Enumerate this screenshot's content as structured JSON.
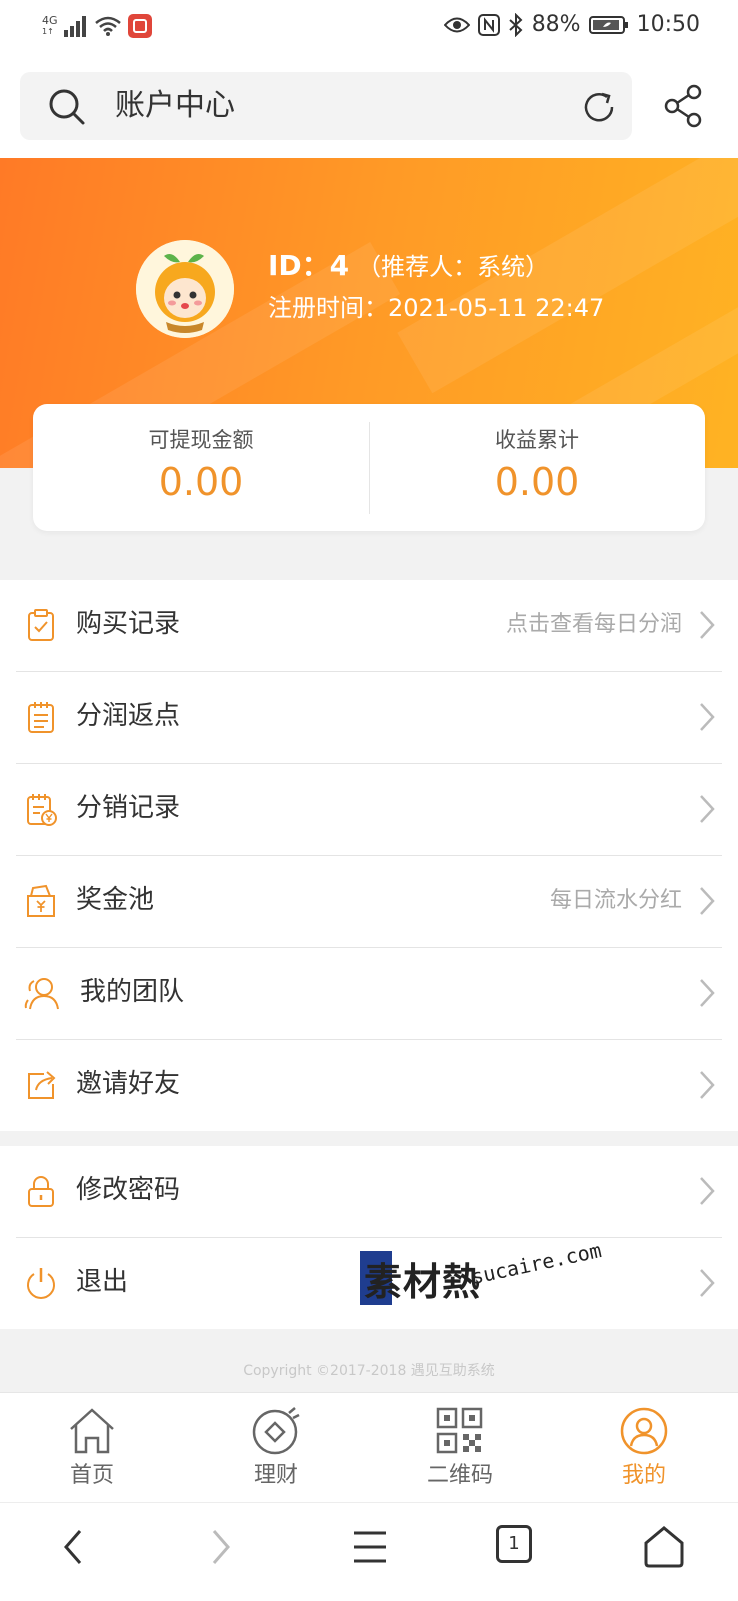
{
  "statusbar": {
    "network": "4G",
    "network_sub": "1↑",
    "battery": "88%",
    "time": "10:50"
  },
  "header": {
    "title": "账户中心"
  },
  "profile": {
    "id_text": "ID：4",
    "referrer_text": "（推荐人：系统）",
    "register_text": "注册时间：2021-05-11 22:47"
  },
  "stats": {
    "withdrawable_label": "可提现金额",
    "withdrawable_value": "0.00",
    "earnings_label": "收益累计",
    "earnings_value": "0.00"
  },
  "menu": [
    {
      "label": "购买记录",
      "hint": "点击查看每日分润",
      "icon": "clipboard-check-icon"
    },
    {
      "label": "分润返点",
      "hint": "",
      "icon": "notepad-icon"
    },
    {
      "label": "分销记录",
      "hint": "",
      "icon": "yuan-record-icon"
    },
    {
      "label": "奖金池",
      "hint": "每日流水分红",
      "icon": "prize-pool-icon"
    },
    {
      "label": "我的团队",
      "hint": "",
      "icon": "team-icon"
    },
    {
      "label": "邀请好友",
      "hint": "",
      "icon": "invite-icon"
    }
  ],
  "menu2": [
    {
      "label": "修改密码",
      "icon": "lock-icon"
    },
    {
      "label": "退出",
      "icon": "power-icon"
    }
  ],
  "watermark": {
    "brand": "素材熱",
    "domain": "sucaire.com"
  },
  "copyright": "Copyright ©2017-2018 遇见互助系统",
  "tabs": [
    {
      "label": "首页",
      "icon": "home-icon"
    },
    {
      "label": "理财",
      "icon": "finance-icon"
    },
    {
      "label": "二维码",
      "icon": "qrcode-icon"
    },
    {
      "label": "我的",
      "icon": "user-icon",
      "active": true
    }
  ],
  "navbar": {
    "tab_count": "1"
  },
  "colors": {
    "accent": "#f0932b",
    "hero_start": "#ff7a26",
    "hero_end": "#ffb323"
  }
}
